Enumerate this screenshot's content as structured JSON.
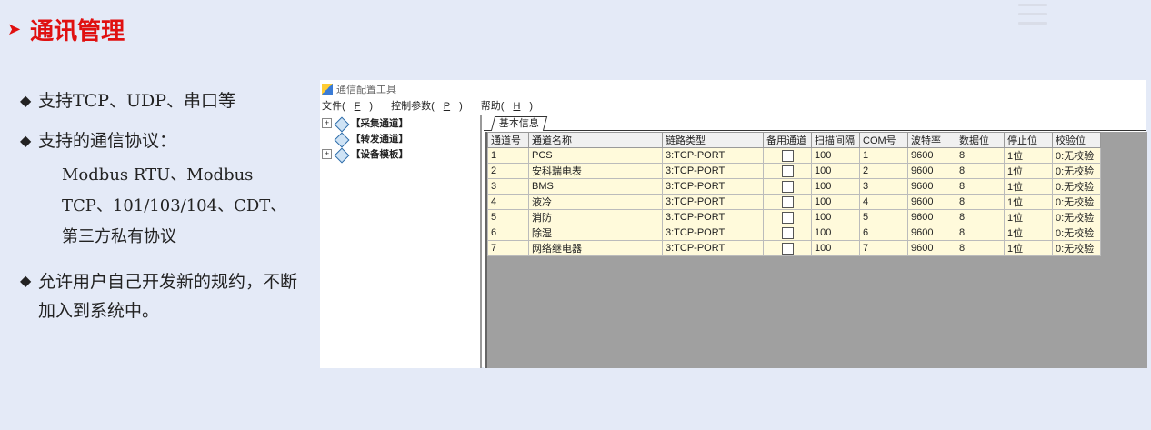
{
  "slide": {
    "title": "通讯管理",
    "title_color": "#e01010",
    "bullets": [
      {
        "text": "支持TCP、UDP、串口等"
      },
      {
        "text": "支持的通信协议："
      },
      {
        "text": "允许用户自己开发新的规约，不断加入到系统中。"
      }
    ],
    "sub_lines": [
      "Modbus RTU、Modbus",
      "TCP、101/103/104、CDT、",
      "第三方私有协议"
    ]
  },
  "app": {
    "title": "通信配置工具",
    "menu": [
      {
        "label": "文件(",
        "key": "F",
        "end": ")"
      },
      {
        "label": "控制参数(",
        "key": "P",
        "end": ")"
      },
      {
        "label": "帮助(",
        "key": "H",
        "end": ")"
      }
    ],
    "tree": [
      {
        "label": "【采集通道】",
        "expandable": true,
        "expander": "+"
      },
      {
        "label": "【转发通道】",
        "expandable": false,
        "expander": ""
      },
      {
        "label": "【设备模板】",
        "expandable": true,
        "expander": "+"
      }
    ],
    "tab": "基本信息",
    "columns": [
      "通道号",
      "通道名称",
      "链路类型",
      "备用通道",
      "扫描间隔",
      "COM号",
      "波特率",
      "数据位",
      "停止位",
      "校验位"
    ],
    "rows": [
      {
        "id": "1",
        "name": "PCS",
        "link": "3:TCP-PORT",
        "backup": false,
        "scan": "100",
        "com": "1",
        "baud": "9600",
        "databits": "8",
        "stopbits": "1位",
        "parity": "0:无校验"
      },
      {
        "id": "2",
        "name": "安科瑞电表",
        "link": "3:TCP-PORT",
        "backup": false,
        "scan": "100",
        "com": "2",
        "baud": "9600",
        "databits": "8",
        "stopbits": "1位",
        "parity": "0:无校验"
      },
      {
        "id": "3",
        "name": "BMS",
        "link": "3:TCP-PORT",
        "backup": false,
        "scan": "100",
        "com": "3",
        "baud": "9600",
        "databits": "8",
        "stopbits": "1位",
        "parity": "0:无校验"
      },
      {
        "id": "4",
        "name": "液冷",
        "link": "3:TCP-PORT",
        "backup": false,
        "scan": "100",
        "com": "4",
        "baud": "9600",
        "databits": "8",
        "stopbits": "1位",
        "parity": "0:无校验"
      },
      {
        "id": "5",
        "name": "消防",
        "link": "3:TCP-PORT",
        "backup": false,
        "scan": "100",
        "com": "5",
        "baud": "9600",
        "databits": "8",
        "stopbits": "1位",
        "parity": "0:无校验"
      },
      {
        "id": "6",
        "name": "除湿",
        "link": "3:TCP-PORT",
        "backup": false,
        "scan": "100",
        "com": "6",
        "baud": "9600",
        "databits": "8",
        "stopbits": "1位",
        "parity": "0:无校验"
      },
      {
        "id": "7",
        "name": "网络继电器",
        "link": "3:TCP-PORT",
        "backup": false,
        "scan": "100",
        "com": "7",
        "baud": "9600",
        "databits": "8",
        "stopbits": "1位",
        "parity": "0:无校验"
      }
    ]
  }
}
